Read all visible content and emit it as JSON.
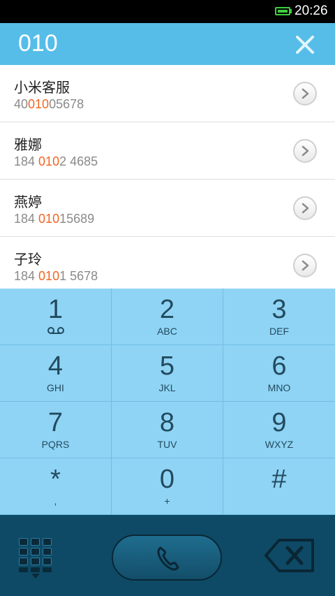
{
  "status_bar": {
    "time": "20:26"
  },
  "search": {
    "query": "010"
  },
  "results": [
    {
      "name": "小米客服",
      "number_pre": "40",
      "number_match": "010",
      "number_post": "05678"
    },
    {
      "name": "雅娜",
      "number_pre": "184 ",
      "number_match": "010",
      "number_post": "2 4685"
    },
    {
      "name": "燕婷",
      "number_pre": "184 ",
      "number_match": "010",
      "number_post": "15689"
    },
    {
      "name": "子玲",
      "number_pre": "184 ",
      "number_match": "010",
      "number_post": "1 5678"
    }
  ],
  "keypad": [
    {
      "digit": "1",
      "letters": ""
    },
    {
      "digit": "2",
      "letters": "ABC"
    },
    {
      "digit": "3",
      "letters": "DEF"
    },
    {
      "digit": "4",
      "letters": "GHI"
    },
    {
      "digit": "5",
      "letters": "JKL"
    },
    {
      "digit": "6",
      "letters": "MNO"
    },
    {
      "digit": "7",
      "letters": "PQRS"
    },
    {
      "digit": "8",
      "letters": "TUV"
    },
    {
      "digit": "9",
      "letters": "WXYZ"
    },
    {
      "digit": "*",
      "letters": ","
    },
    {
      "digit": "0",
      "letters": "+"
    },
    {
      "digit": "#",
      "letters": ""
    }
  ],
  "colors": {
    "header": "#56bde9",
    "match_highlight": "#f26522",
    "keypad": "#8fd4f5",
    "action_bar": "#0e4a66",
    "battery": "#3ecf3e"
  },
  "icons": {
    "battery": "battery-icon",
    "clear": "close-icon",
    "detail": "chevron-right-icon",
    "voicemail": "voicemail-icon",
    "dialpad": "dialpad-grid-icon",
    "call": "phone-icon",
    "backspace": "backspace-icon"
  }
}
